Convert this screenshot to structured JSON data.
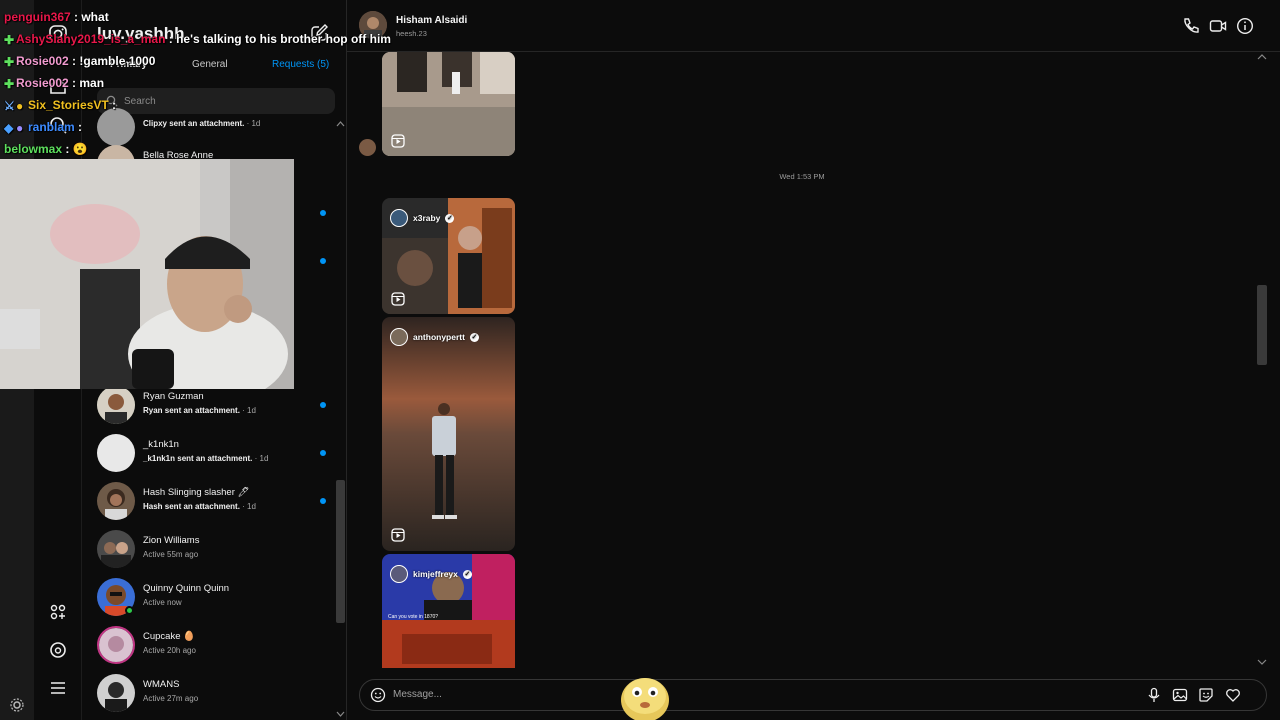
{
  "inbox": {
    "title": "luv.yashhh",
    "tabs": [
      {
        "label": "Primary"
      },
      {
        "label": "General"
      },
      {
        "label": "Requests (5)"
      }
    ],
    "search_placeholder": "Search",
    "threads": [
      {
        "name": "",
        "sender": "Clipxy sent an attachment.",
        "time": "· 1d",
        "unread": false
      },
      {
        "name": "Bella Rose Anne",
        "sender": "",
        "time": "",
        "unread": false
      },
      {
        "name": "Ryan Guzman",
        "sender": "Ryan sent an attachment.",
        "time": "· 1d",
        "unread": true
      },
      {
        "name": "_k1nk1n",
        "sender": "_k1nk1n sent an attachment.",
        "time": "· 1d",
        "unread": true
      },
      {
        "name": "Hash Slinging slasher 🖊",
        "sender": "Hash sent an attachment.",
        "time": "· 1d",
        "unread": true
      },
      {
        "name": "Zion Williams",
        "status": "Active 55m ago"
      },
      {
        "name": "Quinny Quinn Quinn",
        "status": "Active now",
        "online": true
      },
      {
        "name": "Cupcake 🥚",
        "status": "Active 20h ago"
      },
      {
        "name": "WMANS",
        "status": "Active 27m ago"
      }
    ]
  },
  "chat": {
    "name": "Hisham Alsaidi",
    "username": "heesh.23",
    "timestamp": "Wed 1:53 PM",
    "reels": [
      {
        "user": "x3raby",
        "verified": true
      },
      {
        "user": "anthonypertt",
        "verified": true
      },
      {
        "user": "kimjeffreyx",
        "verified": true,
        "caption": "Can you vote in 1870?"
      }
    ],
    "composer_placeholder": "Message..."
  },
  "stream_chat": [
    {
      "user": "penguin367",
      "message": " : what",
      "color": "#e8184a"
    },
    {
      "user": "AshySlahy2019_is_a_man",
      "message": " : he's talking to his brother hop off him",
      "color": "#e8184a"
    },
    {
      "user": "Rosie002",
      "message": " : !gamble 1000",
      "color": "#f29bd0"
    },
    {
      "user": "Rosie002",
      "message": " : man",
      "color": "#f29bd0"
    },
    {
      "user": "Six_StoriesVT",
      "message": " :",
      "color": "#f0c020"
    },
    {
      "user": "ranblam",
      "message": " : ",
      "color": "#3d8bff"
    },
    {
      "user": "belowmax",
      "message": " : 😮",
      "color": "#5ee05e"
    }
  ],
  "colors": {
    "accent": "#0095f6",
    "online": "#2ec94a",
    "background": "#0c0c0c"
  }
}
